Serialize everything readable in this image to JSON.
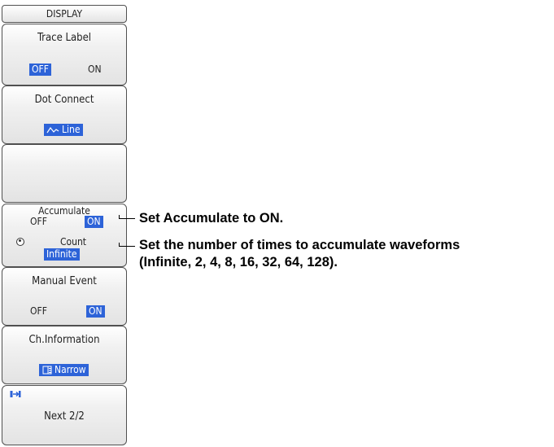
{
  "menu": {
    "title": "DISPLAY",
    "trace_label": {
      "title": "Trace Label",
      "off": "OFF",
      "on": "ON",
      "selected": "OFF"
    },
    "dot_connect": {
      "title": "Dot Connect",
      "value": "Line",
      "icon": "line-waveform-icon"
    },
    "empty": {},
    "accumulate": {
      "title": "Accumulate",
      "off": "OFF",
      "on": "ON",
      "selected": "ON",
      "knob_icon": "rotary-knob-icon",
      "count_label": "Count",
      "count_value": "Infinite"
    },
    "manual_event": {
      "title": "Manual Event",
      "off": "OFF",
      "on": "ON",
      "selected": "ON"
    },
    "ch_information": {
      "title": "Ch.Information",
      "value": "Narrow",
      "icon": "narrow-panel-icon"
    },
    "next": {
      "label": "Next 2/2",
      "icon": "next-page-icon"
    }
  },
  "annotations": {
    "accumulate": "Set Accumulate to ON.",
    "count_line1": "Set the number of times to accumulate waveforms",
    "count_line2": "(Infinite, 2, 4, 8, 16, 32, 64, 128)."
  },
  "colors": {
    "selected_bg": "#2d63d8",
    "selected_fg": "#ffffff",
    "key_border": "#505050"
  }
}
